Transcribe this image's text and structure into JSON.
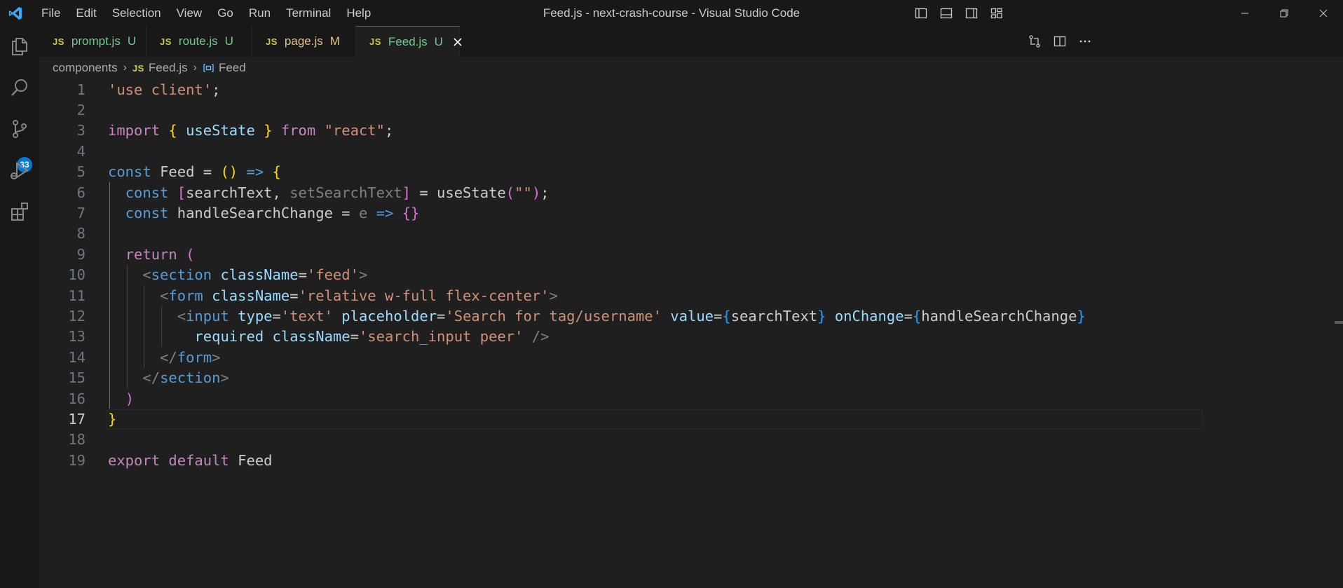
{
  "titlebar": {
    "menu": [
      "File",
      "Edit",
      "Selection",
      "View",
      "Go",
      "Run",
      "Terminal",
      "Help"
    ],
    "title": "Feed.js - next-crash-course - Visual Studio Code"
  },
  "activity": {
    "scm_badge": "33"
  },
  "tabs": [
    {
      "icon": "JS",
      "name": "prompt.js",
      "status": "U"
    },
    {
      "icon": "JS",
      "name": "route.js",
      "status": "U"
    },
    {
      "icon": "JS",
      "name": "page.js",
      "status": "M"
    },
    {
      "icon": "JS",
      "name": "Feed.js",
      "status": "U"
    }
  ],
  "breadcrumb": {
    "folder": "components",
    "file_icon": "JS",
    "file": "Feed.js",
    "symbol": "Feed"
  },
  "editor": {
    "current_line": 17,
    "lines": [
      [
        [
          "'use client'",
          "str"
        ],
        [
          ";",
          "op"
        ]
      ],
      [],
      [
        [
          "import",
          "ctl"
        ],
        [
          " ",
          "op"
        ],
        [
          "{",
          "b1"
        ],
        [
          " useState ",
          "var"
        ],
        [
          "}",
          "b1"
        ],
        [
          " ",
          "op"
        ],
        [
          "from",
          "ctl"
        ],
        [
          " ",
          "op"
        ],
        [
          "\"react\"",
          "str"
        ],
        [
          ";",
          "op"
        ]
      ],
      [],
      [
        [
          "const",
          "kw"
        ],
        [
          " ",
          "op"
        ],
        [
          "Feed",
          "def"
        ],
        [
          " = ",
          "op"
        ],
        [
          "()",
          "b1"
        ],
        [
          " ",
          "op"
        ],
        [
          "=>",
          "kw"
        ],
        [
          " ",
          "op"
        ],
        [
          "{",
          "b1"
        ]
      ],
      [
        [
          "  ",
          "op"
        ],
        [
          "const",
          "kw"
        ],
        [
          " ",
          "op"
        ],
        [
          "[",
          "b2"
        ],
        [
          "searchText",
          "def"
        ],
        [
          ", ",
          "op"
        ],
        [
          "setSearchText",
          "punct"
        ],
        [
          "]",
          "b2"
        ],
        [
          " = ",
          "op"
        ],
        [
          "useState",
          "def"
        ],
        [
          "(",
          "b2"
        ],
        [
          "\"\"",
          "str"
        ],
        [
          ")",
          "b2"
        ],
        [
          ";",
          "op"
        ]
      ],
      [
        [
          "  ",
          "op"
        ],
        [
          "const",
          "kw"
        ],
        [
          " ",
          "op"
        ],
        [
          "handleSearchChange",
          "def"
        ],
        [
          " = ",
          "op"
        ],
        [
          "e",
          "punct"
        ],
        [
          " ",
          "op"
        ],
        [
          "=>",
          "kw"
        ],
        [
          " ",
          "op"
        ],
        [
          "{}",
          "b2"
        ]
      ],
      [],
      [
        [
          "  ",
          "op"
        ],
        [
          "return",
          "ctl"
        ],
        [
          " ",
          "op"
        ],
        [
          "(",
          "b2"
        ]
      ],
      [
        [
          "    ",
          "op"
        ],
        [
          "<",
          "punct"
        ],
        [
          "section",
          "tag"
        ],
        [
          " ",
          "op"
        ],
        [
          "className",
          "attr"
        ],
        [
          "=",
          "op"
        ],
        [
          "'feed'",
          "str"
        ],
        [
          ">",
          "punct"
        ]
      ],
      [
        [
          "      ",
          "op"
        ],
        [
          "<",
          "punct"
        ],
        [
          "form",
          "tag"
        ],
        [
          " ",
          "op"
        ],
        [
          "className",
          "attr"
        ],
        [
          "=",
          "op"
        ],
        [
          "'relative w-full flex-center'",
          "str"
        ],
        [
          ">",
          "punct"
        ]
      ],
      [
        [
          "        ",
          "op"
        ],
        [
          "<",
          "punct"
        ],
        [
          "input",
          "tag"
        ],
        [
          " ",
          "op"
        ],
        [
          "type",
          "attr"
        ],
        [
          "=",
          "op"
        ],
        [
          "'text'",
          "str"
        ],
        [
          " ",
          "op"
        ],
        [
          "placeholder",
          "attr"
        ],
        [
          "=",
          "op"
        ],
        [
          "'Search for tag/username'",
          "str"
        ],
        [
          " ",
          "op"
        ],
        [
          "value",
          "attr"
        ],
        [
          "=",
          "op"
        ],
        [
          "{",
          "b3"
        ],
        [
          "searchText",
          "def"
        ],
        [
          "}",
          "b3"
        ],
        [
          " ",
          "op"
        ],
        [
          "onChange",
          "attr"
        ],
        [
          "=",
          "op"
        ],
        [
          "{",
          "b3"
        ],
        [
          "handleSearchChange",
          "def"
        ],
        [
          "}",
          "b3"
        ]
      ],
      [
        [
          "          ",
          "op"
        ],
        [
          "required",
          "attr"
        ],
        [
          " ",
          "op"
        ],
        [
          "className",
          "attr"
        ],
        [
          "=",
          "op"
        ],
        [
          "'search_input peer'",
          "str"
        ],
        [
          " ",
          "op"
        ],
        [
          "/>",
          "punct"
        ]
      ],
      [
        [
          "      ",
          "op"
        ],
        [
          "</",
          "punct"
        ],
        [
          "form",
          "tag"
        ],
        [
          ">",
          "punct"
        ]
      ],
      [
        [
          "    ",
          "op"
        ],
        [
          "</",
          "punct"
        ],
        [
          "section",
          "tag"
        ],
        [
          ">",
          "punct"
        ]
      ],
      [
        [
          "  ",
          "op"
        ],
        [
          ")",
          "b2"
        ]
      ],
      [
        [
          "}",
          "b1"
        ]
      ],
      [],
      [
        [
          "export",
          "ctl"
        ],
        [
          " ",
          "op"
        ],
        [
          "default",
          "ctl"
        ],
        [
          " ",
          "op"
        ],
        [
          "Feed",
          "def"
        ]
      ]
    ]
  }
}
